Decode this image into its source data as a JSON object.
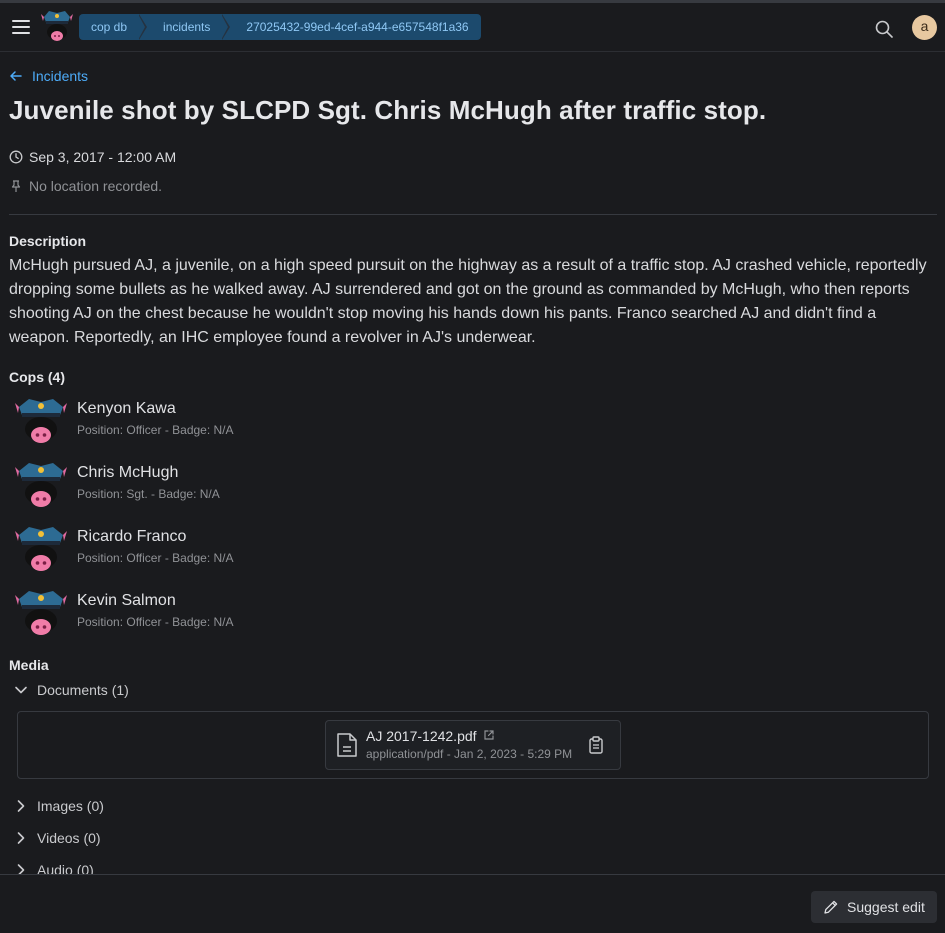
{
  "header": {
    "breadcrumbs": [
      "cop db",
      "incidents",
      "27025432-99ed-4cef-a944-e657548f1a36"
    ],
    "avatar_initial": "a"
  },
  "back_link": "Incidents",
  "title": "Juvenile shot by SLCPD Sgt. Chris McHugh after traffic stop.",
  "date": "Sep 3, 2017 - 12:00 AM",
  "location": "No location recorded.",
  "description_heading": "Description",
  "description": "McHugh pursued AJ, a juvenile, on a high speed pursuit on the highway as a result of a traffic stop. AJ crashed vehicle, reportedly dropping some bullets as he walked away. AJ surrendered and got on the ground as commanded by McHugh, who then reports shooting AJ on the chest because he wouldn't stop moving his hands down his pants. Franco searched AJ and didn't find a weapon. Reportedly, an IHC employee found a revolver in AJ's underwear.",
  "cops_heading": "Cops (4)",
  "cops": [
    {
      "name": "Kenyon Kawa",
      "details": "Position: Officer - Badge: N/A"
    },
    {
      "name": "Chris McHugh",
      "details": "Position: Sgt. - Badge: N/A"
    },
    {
      "name": "Ricardo Franco",
      "details": "Position: Officer - Badge: N/A"
    },
    {
      "name": "Kevin Salmon",
      "details": "Position: Officer - Badge: N/A"
    }
  ],
  "media_heading": "Media",
  "media": {
    "documents": "Documents (1)",
    "images": "Images (0)",
    "videos": "Videos (0)",
    "audio": "Audio (0)"
  },
  "document": {
    "filename": "AJ 2017-1242.pdf",
    "meta": "application/pdf - Jan 2, 2023 - 5:29 PM"
  },
  "suggest_edit": "Suggest edit",
  "colors": {
    "accent": "#4dabf7",
    "breadcrumb_bg": "#1c4a6d",
    "background": "#1a1b1e"
  }
}
